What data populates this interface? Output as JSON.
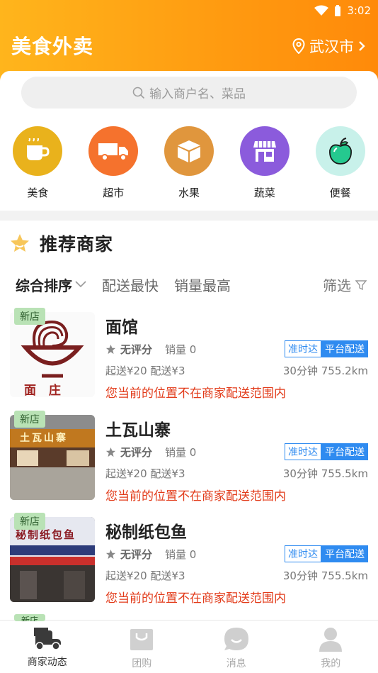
{
  "status": {
    "time": "3:02"
  },
  "header": {
    "title": "美食外卖",
    "city": "武汉市"
  },
  "search": {
    "placeholder": "输入商户名、菜品"
  },
  "categories": [
    {
      "label": "美食",
      "icon": "coffee-cup-icon",
      "color": "#e9b21c"
    },
    {
      "label": "超市",
      "icon": "truck-icon",
      "color": "#f5722d"
    },
    {
      "label": "水果",
      "icon": "box-icon",
      "color": "#e0963d"
    },
    {
      "label": "蔬菜",
      "icon": "store-icon",
      "color": "#8b5bdc"
    },
    {
      "label": "便餐",
      "icon": "apple-icon",
      "color": "#c8f1ea"
    }
  ],
  "section": {
    "title": "推荐商家"
  },
  "sort": {
    "items": [
      "综合排序",
      "配送最快",
      "销量最高"
    ],
    "filter": "筛选"
  },
  "shops": [
    {
      "badge": "新店",
      "name": "面馆",
      "rating": "无评分",
      "sales": "销量 0",
      "tag1": "准时达",
      "tag2": "平台配送",
      "fees": "起送¥20  配送¥3",
      "distance": "30分钟 755.2km",
      "warning": "您当前的位置不在商家配送范围内",
      "thumb_text": "面 庄"
    },
    {
      "badge": "新店",
      "name": "土瓦山寨",
      "rating": "无评分",
      "sales": "销量 0",
      "tag1": "准时达",
      "tag2": "平台配送",
      "fees": "起送¥20  配送¥3",
      "distance": "30分钟 755.5km",
      "warning": "您当前的位置不在商家配送范围内",
      "thumb_text": "土瓦山寨"
    },
    {
      "badge": "新店",
      "name": "秘制纸包鱼",
      "rating": "无评分",
      "sales": "销量 0",
      "tag1": "准时达",
      "tag2": "平台配送",
      "fees": "起送¥20  配送¥3",
      "distance": "30分钟 755.5km",
      "warning": "您当前的位置不在商家配送范围内",
      "thumb_text": "秘制纸包鱼"
    }
  ],
  "next_badge": "新店",
  "tabs": [
    {
      "label": "商家动态",
      "icon": "scooter-icon",
      "active": true
    },
    {
      "label": "团购",
      "icon": "shopping-bag-icon",
      "active": false
    },
    {
      "label": "消息",
      "icon": "chat-bubble-icon",
      "active": false
    },
    {
      "label": "我的",
      "icon": "user-icon",
      "active": false
    }
  ]
}
